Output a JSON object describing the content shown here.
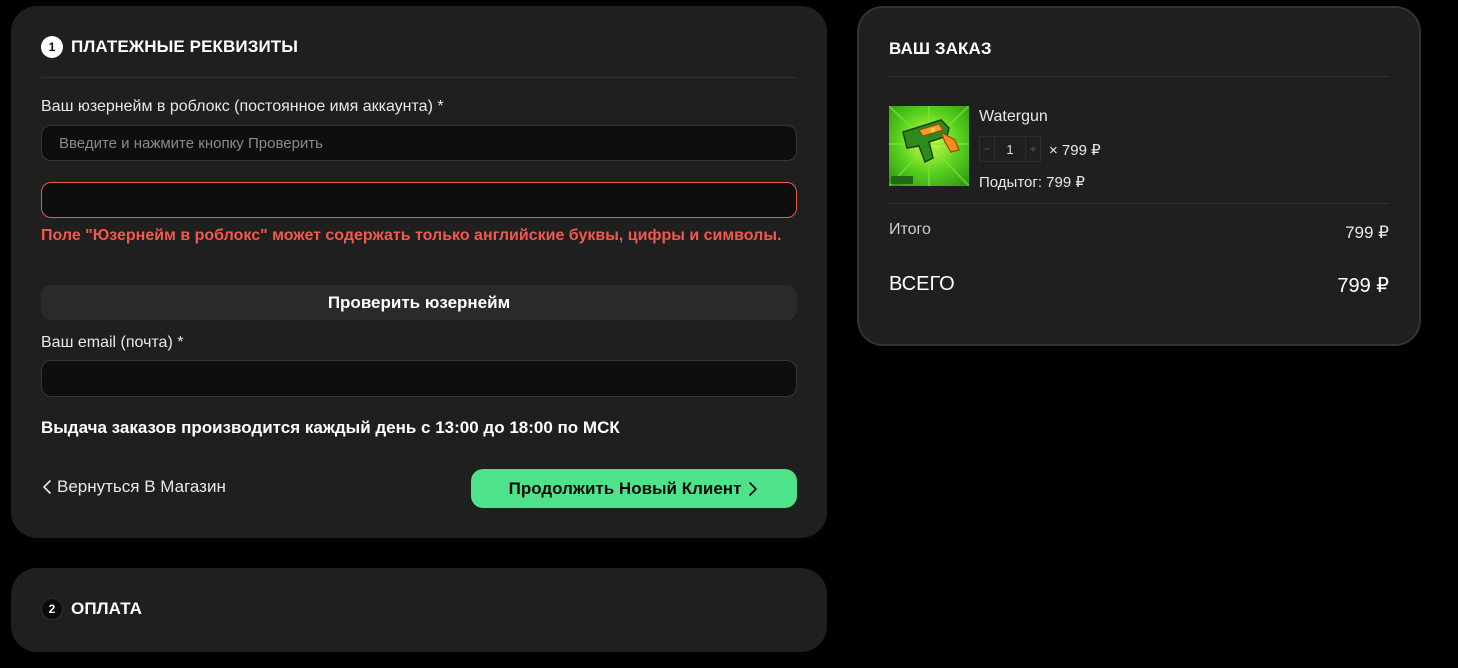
{
  "billing": {
    "step_number": "1",
    "title": "ПЛАТЕЖНЫЕ РЕКВИЗИТЫ",
    "username_label": "Ваш юзернейм в роблокс (постоянное имя аккаунта) *",
    "username_placeholder": "Введите и нажмите кнопку Проверить",
    "username_value": "",
    "error_input_value": "",
    "error_message": "Поле \"Юзернейм в роблокс\" может содержать только английские буквы, цифры и символы.",
    "check_button": "Проверить юзернейм",
    "email_label": "Ваш email (почта) *",
    "email_value": "",
    "notice": "Выдача заказов производится каждый день с 13:00 до 18:00 по МСК",
    "back_link": "Вернуться В Магазин",
    "continue_button": "Продолжить Новый Клиент"
  },
  "payment": {
    "step_number": "2",
    "title": "ОПЛАТА"
  },
  "order": {
    "title": "ВАШ ЗАКАЗ",
    "item": {
      "name": "Watergun",
      "quantity": "1",
      "price": "× 799 ₽",
      "subtotal": "Подытог: 799 ₽",
      "decrease_symbol": "−",
      "increase_symbol": "+"
    },
    "subtotal_label": "Итого",
    "subtotal_value": "799 ₽",
    "total_label": "ВСЕГО",
    "total_value": "799 ₽"
  },
  "colors": {
    "accent_green": "#4ee28a",
    "error_red": "#f05a4e",
    "card_bg": "#1f1f1f"
  },
  "icons": {
    "back": "chevron-left-icon",
    "continue": "chevron-right-icon"
  }
}
